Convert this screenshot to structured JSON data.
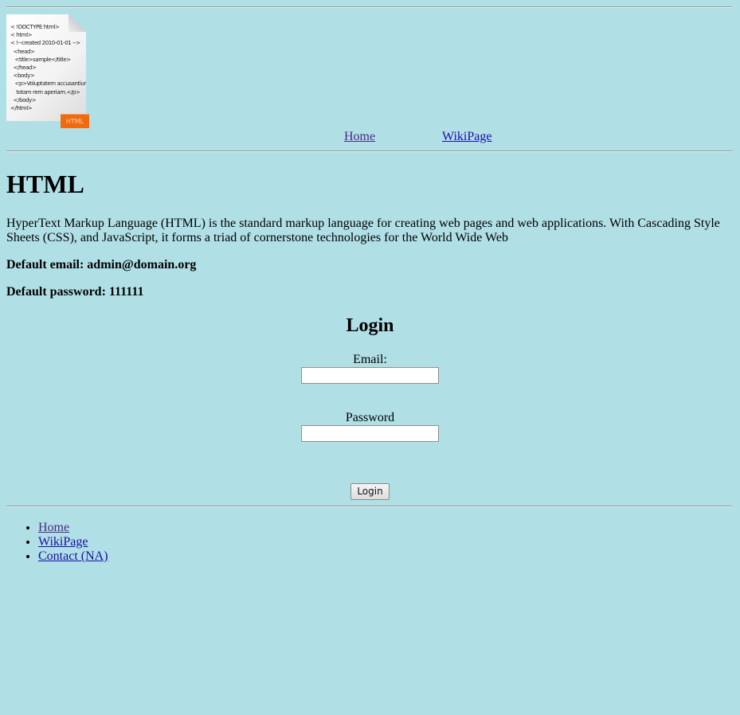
{
  "logo": {
    "code_lines": [
      "< !DOCTYPE html>",
      "< html>",
      "< !--created 2010-01-01 -->",
      "  <head>",
      "   <title>sample</title>",
      "  </head>",
      "  <body>",
      "   <p>Voluptatem accusantium",
      "    totam rem aperiam.</p>",
      "  </body>",
      "</html>"
    ],
    "badge": "HTML"
  },
  "top_nav": {
    "home": "Home",
    "wiki": "WikiPage"
  },
  "main": {
    "title": "HTML",
    "description": "HyperText Markup Language (HTML) is the standard markup language for creating web pages and web applications. With Cascading Style Sheets (CSS), and JavaScript, it forms a triad of cornerstone technologies for the World Wide Web",
    "default_email": "Default email: admin@domain.org",
    "default_password": "Default password: 111111"
  },
  "login": {
    "heading": "Login",
    "email_label": "Email:",
    "email_value": "",
    "password_label": "Password",
    "password_value": "",
    "button": "Login"
  },
  "footer_nav": {
    "items": [
      "Home",
      "WikiPage",
      "Contact (NA)"
    ]
  },
  "colors": {
    "background": "#b0e0e6",
    "link": "#1a0dab",
    "visited_link": "#4b2a86",
    "badge": "#f06a10"
  }
}
